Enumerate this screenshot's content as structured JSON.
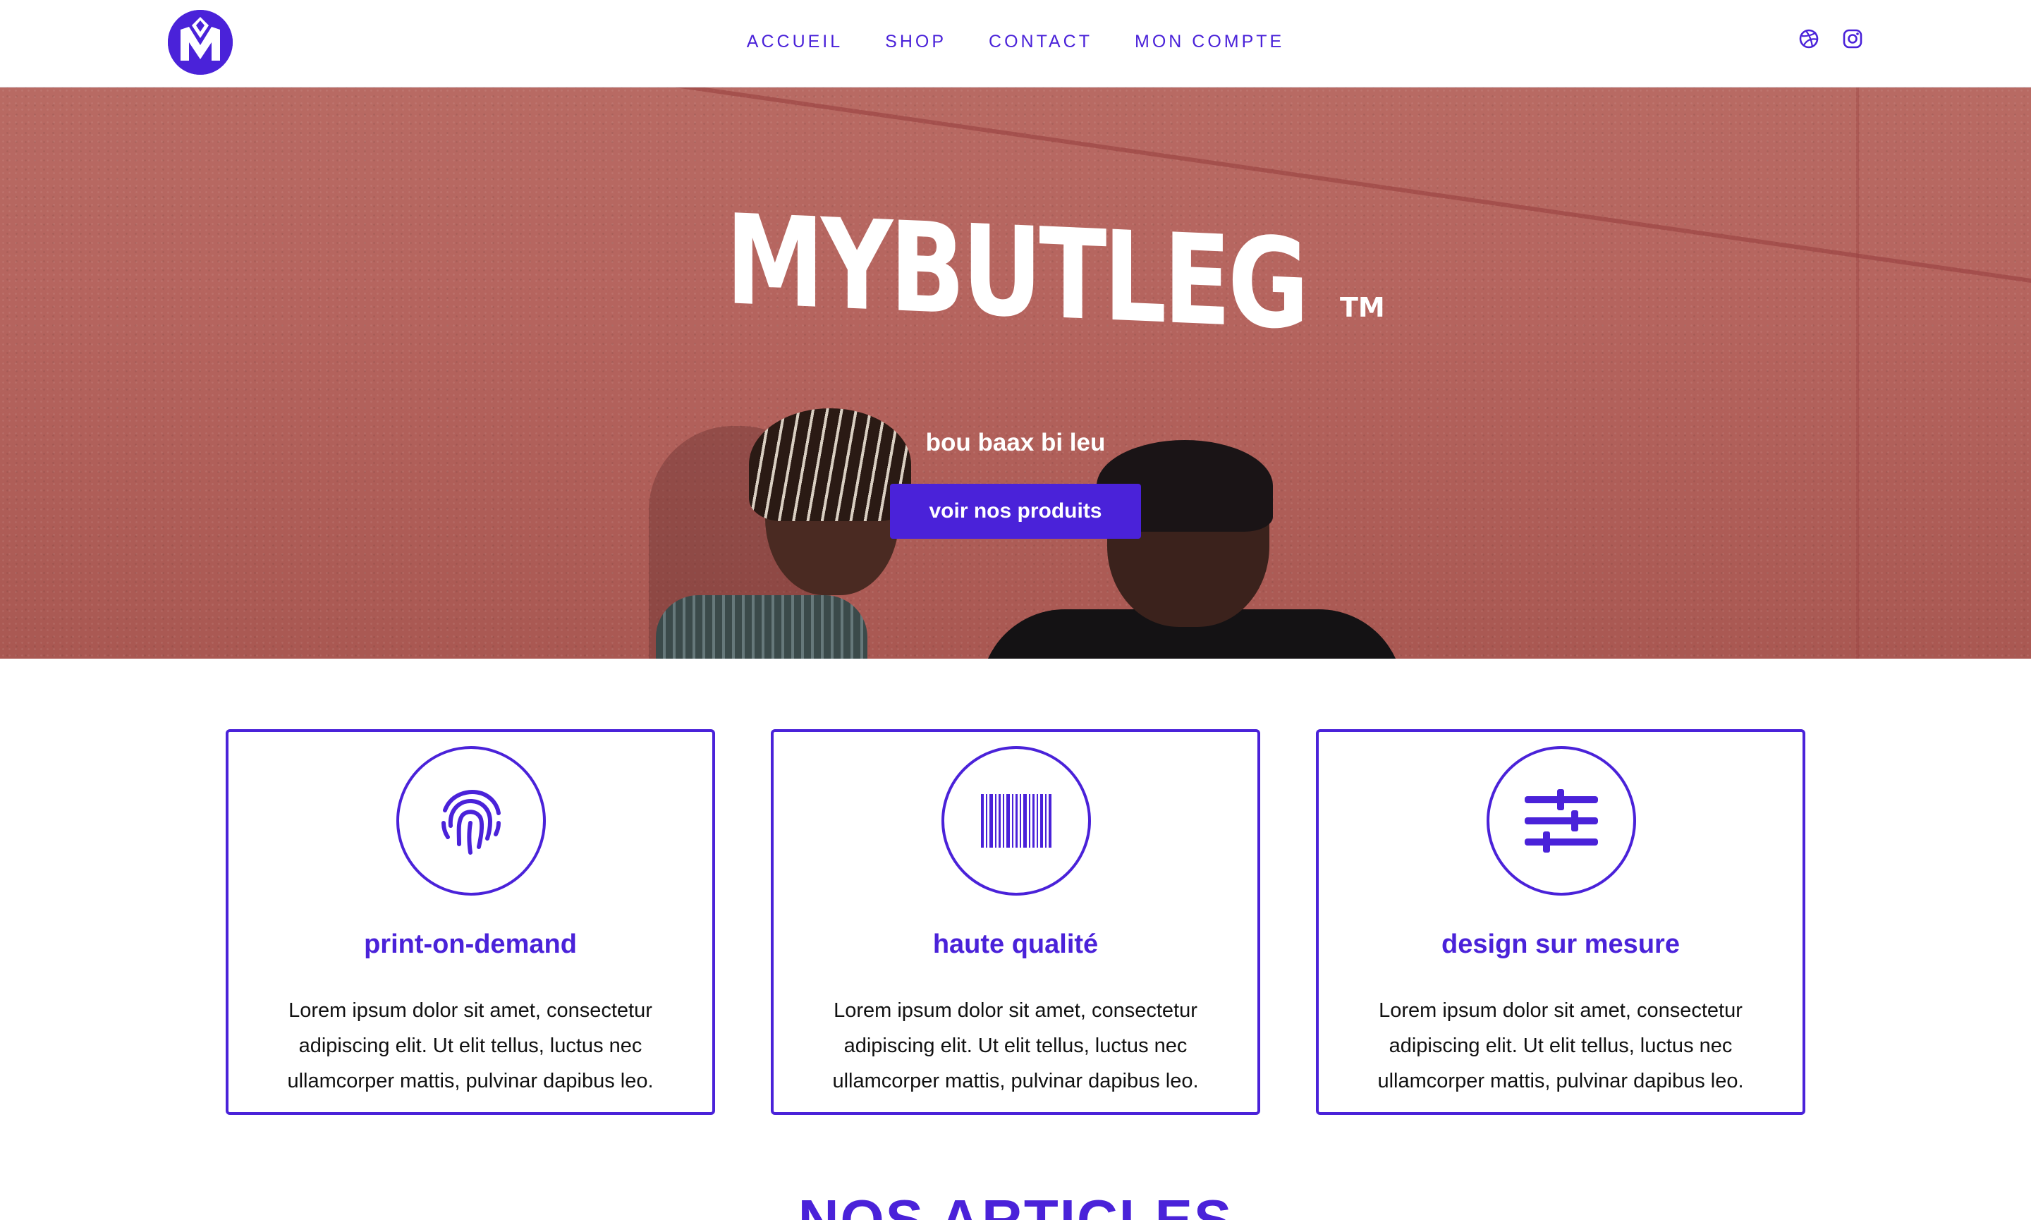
{
  "header": {
    "nav": [
      {
        "label": "ACCUEIL"
      },
      {
        "label": "SHOP"
      },
      {
        "label": "CONTACT"
      },
      {
        "label": "MON COMPTE"
      }
    ],
    "social_icons": [
      "dribbble-icon",
      "instagram-icon"
    ]
  },
  "hero": {
    "brand": "MYBUTLEG",
    "trademark": "TM",
    "tagline": "bou baax bi leu",
    "cta_label": "voir nos produits"
  },
  "features": [
    {
      "icon": "fingerprint-icon",
      "title": "print-on-demand",
      "text": "Lorem ipsum dolor sit amet, consectetur adipiscing elit. Ut elit tellus, luctus nec ullamcorper mattis, pulvinar dapibus leo."
    },
    {
      "icon": "barcode-icon",
      "title": "haute qualité",
      "text": "Lorem ipsum dolor sit amet, consectetur adipiscing elit. Ut elit tellus, luctus nec ullamcorper mattis, pulvinar dapibus leo."
    },
    {
      "icon": "sliders-icon",
      "title": "design sur mesure",
      "text": "Lorem ipsum dolor sit amet, consectetur adipiscing elit. Ut elit tellus, luctus nec ullamcorper mattis, pulvinar dapibus leo."
    }
  ],
  "section": {
    "title": "NOS ARTICLES"
  },
  "colors": {
    "accent": "#4a22d9",
    "hero_wall": "#b5645e",
    "text": "#111111"
  }
}
